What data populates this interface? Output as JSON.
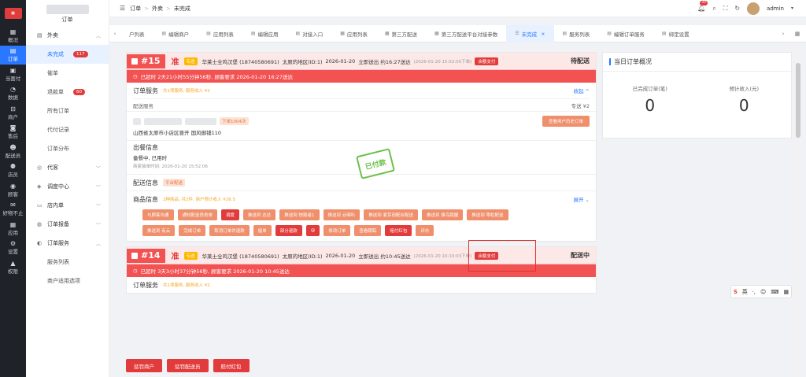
{
  "rail": {
    "logo": "",
    "items": [
      {
        "icon": "▦",
        "label": "概况"
      },
      {
        "icon": "▤",
        "label": "订单"
      },
      {
        "icon": "▣",
        "label": "当面付"
      },
      {
        "icon": "◔",
        "label": "数据"
      },
      {
        "icon": "⊟",
        "label": "商户"
      },
      {
        "icon": "◙",
        "label": "售后"
      },
      {
        "icon": "☻",
        "label": "配送员"
      },
      {
        "icon": "⚉",
        "label": "店员"
      },
      {
        "icon": "◉",
        "label": "顾客"
      },
      {
        "icon": "✉",
        "label": "好物不止"
      },
      {
        "icon": "▦",
        "label": "应用"
      },
      {
        "icon": "⚙",
        "label": "设置"
      },
      {
        "icon": "▲",
        "label": "权限"
      }
    ],
    "active_index": 1
  },
  "submenu": {
    "title": "订单",
    "group_takeaway": "外卖",
    "item_unfinished": "未完成",
    "badge_unfinished": "117",
    "item_pending": "催单",
    "item_refund": "退款单",
    "badge_refund": "60",
    "item_all": "所有订单",
    "item_proxy": "代付记录",
    "item_dist": "订单分布",
    "group_agent": "代客",
    "group_dispatch": "调度中心",
    "group_store": "店内单",
    "group_order_report": "订单报备",
    "group_order_service": "订单服务",
    "item_service_list": "服务列表",
    "item_merchant_options": "商户适用选项"
  },
  "topbar": {
    "crumb1": "订单",
    "crumb2": "外卖",
    "crumb3": "未完成",
    "bell_count": "30",
    "user": "admin"
  },
  "tabs": [
    {
      "label": "户列表",
      "icon": ""
    },
    {
      "label": "编辑商户",
      "icon": "▤"
    },
    {
      "label": "应用列表",
      "icon": "▤"
    },
    {
      "label": "编辑应用",
      "icon": "▤"
    },
    {
      "label": "对接入口",
      "icon": "▤"
    },
    {
      "label": "应用列表",
      "icon": "▦"
    },
    {
      "label": "第三方配送",
      "icon": "▦"
    },
    {
      "label": "第三方配送平台对接参数",
      "icon": "▦"
    },
    {
      "label": "未完成",
      "icon": "☰"
    },
    {
      "label": "服务列表",
      "icon": "▤"
    },
    {
      "label": "编辑订单服务",
      "icon": "▤"
    },
    {
      "label": "绑定设置",
      "icon": "▤"
    }
  ],
  "order1": {
    "no": "#15",
    "zhun": "准",
    "tag": "专送",
    "customer": "华莱士全鸡汉堡 (18740580691)",
    "area": "太原的地区(ID:1)",
    "date": "2026-01-20",
    "deliver": "立即送出 约16:27送达",
    "placed": "(2026-01-20 15:52:00下单)",
    "pay_tag": "余额支付",
    "status": "待配送",
    "alert": "已超时 2天21小时55分钟56秒, 顾客要求 2026-01-20 16:27送达",
    "svc_title": "订单服务",
    "svc_sub": "共1项服务, 服务收入 ¥2",
    "collapse": "收起 ^",
    "svc_line": "配送服务",
    "svc_line_right": "专送 ¥2",
    "addr_tag": "下单1004次",
    "address": "山西省太原市小店区晋开 国风御铺110",
    "history_btn": "查看用户历史订单",
    "stamp": "已付款",
    "meal_title": "出餐信息",
    "meal_status": "备餐中, 已用时",
    "meal_time": "商家接单时间: 2026-01-20 15:52:06",
    "dist_title": "配送信息",
    "dist_tag": "平台配送",
    "goods_title": "商品信息",
    "goods_sub": "2种商品, 共2件, 商户预计收入 ¥26.5",
    "expand": "展开 ⌄",
    "row1": [
      "与顾客沟通",
      "通知配送员抢单",
      "调度",
      "推送到 达达",
      "推送到 快跑者1",
      "推送到 云喇叭",
      "推送到 麦芽田配合配送",
      "推送到 烽鸟跑腿",
      "推送到 零粒配送"
    ],
    "row2": [
      "推送到 有云",
      "完成订单",
      "取消订单并退款",
      "催单",
      "部分退款",
      "@",
      "修改订单",
      "查看跟踪",
      "赔付红包",
      "评价"
    ]
  },
  "order2": {
    "no": "#14",
    "zhun": "准",
    "tag": "专送",
    "customer": "华莱士全鸡汉堡 (18740580691)",
    "area": "太原的地区(ID:1)",
    "date": "2026-01-20",
    "deliver": "立即送出 约10:45送达",
    "placed": "(2026-01-20 10:10:03下单)",
    "pay_tag": "余额支付",
    "status": "配送中",
    "alert": "已超时 3天3小时37分钟56秒, 顾客要求 2026-01-20 10:45送达",
    "svc_title": "订单服务",
    "svc_sub": "共1项服务, 服务收入 ¥2"
  },
  "bottom_buttons": [
    "惩罚商户",
    "惩罚配送员",
    "赔付红包"
  ],
  "overview": {
    "title": "当日订单概况",
    "label1": "已完成订单(笔)",
    "value1": "0",
    "label2": "预计收入(元)",
    "value2": "0"
  },
  "ime": {
    "s": "S",
    "lang": "英",
    "items": [
      "·,",
      "☺",
      "⌨",
      "▦"
    ]
  }
}
